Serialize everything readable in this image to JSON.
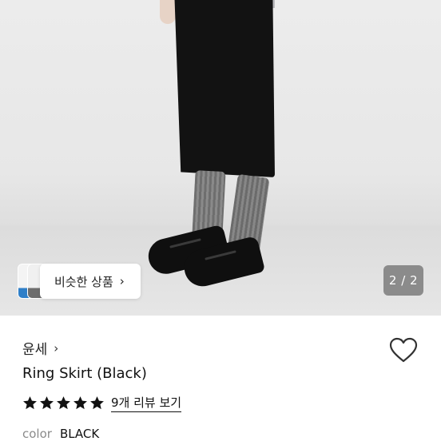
{
  "gallery": {
    "page_indicator": "2 / 2",
    "similar_products_label": "비슷한 상품",
    "chevron": "›",
    "thumb_accent_color": "#2f7fc8"
  },
  "product": {
    "seller_name": "윤세",
    "seller_chevron": "›",
    "title": "Ring Skirt (Black)",
    "rating_stars": 5,
    "review_link": "9개 리뷰 보기",
    "color_label": "color",
    "color_value": "BLACK"
  },
  "icons": {
    "heart": "heart-outline-icon",
    "star": "star-filled-icon"
  }
}
